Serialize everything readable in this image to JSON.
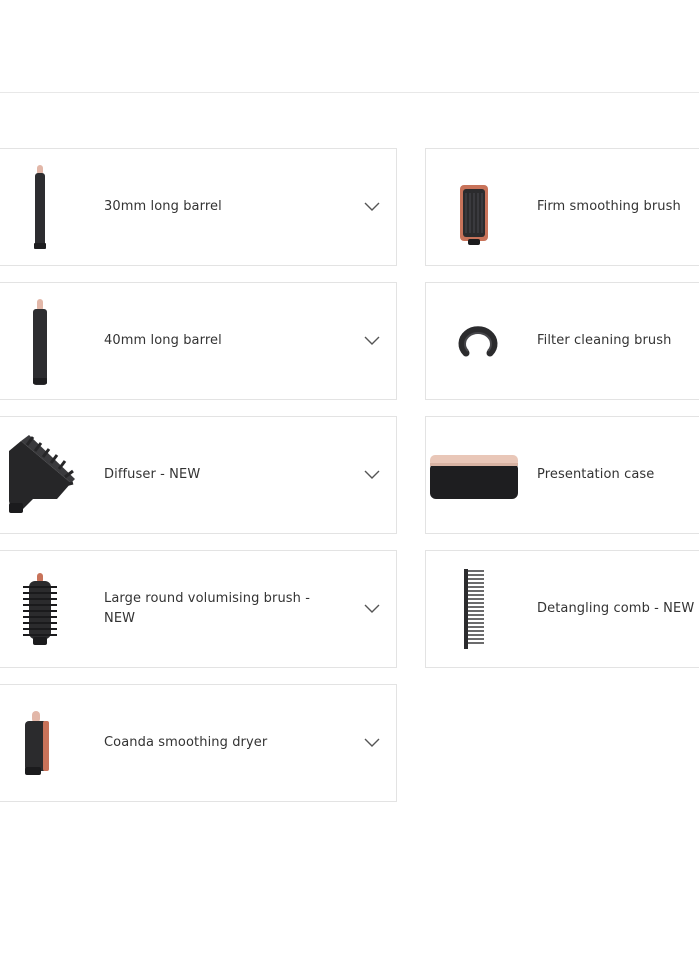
{
  "colors": {
    "accent_copper": "#c8735a",
    "product_dark": "#2b2b2d",
    "card_border": "#e3e3e3",
    "text": "#333333"
  },
  "components_left": [
    {
      "label": "30mm long barrel",
      "icon": "long-barrel-icon",
      "expandable": true
    },
    {
      "label": "40mm long barrel",
      "icon": "long-barrel-icon",
      "expandable": true
    },
    {
      "label": "Diffuser - NEW",
      "icon": "diffuser-icon",
      "expandable": true
    },
    {
      "label": "Large round volumising brush - NEW",
      "icon": "round-brush-icon",
      "expandable": true
    },
    {
      "label": "Coanda smoothing dryer",
      "icon": "smoothing-dryer-icon",
      "expandable": true
    }
  ],
  "components_right": [
    {
      "label": "Firm smoothing brush",
      "icon": "smoothing-brush-icon"
    },
    {
      "label": "Filter cleaning brush",
      "icon": "filter-brush-icon"
    },
    {
      "label": "Presentation case",
      "icon": "presentation-case-icon"
    },
    {
      "label": "Detangling comb - NEW",
      "icon": "comb-icon"
    }
  ],
  "chevron_icon": "chevron-down-icon"
}
